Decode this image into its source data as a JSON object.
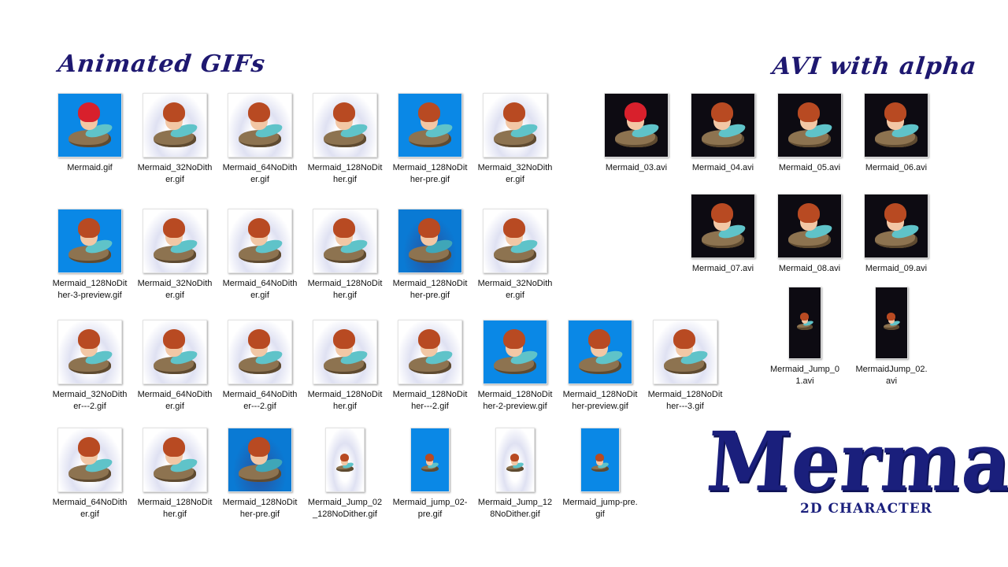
{
  "sections": {
    "gifs_title": "Animated GIFs",
    "avi_title": "AVI with alpha"
  },
  "files": [
    {
      "name": "Mermaid.gif",
      "bg": "blue",
      "icon": "mermaid-thumbnail-icon"
    },
    {
      "name": "Mermaid_32NoDither.gif",
      "bg": "white",
      "icon": "mermaid-thumbnail-icon"
    },
    {
      "name": "Mermaid_64NoDither.gif",
      "bg": "white",
      "icon": "mermaid-thumbnail-icon"
    },
    {
      "name": "Mermaid_128NoDither.gif",
      "bg": "white",
      "icon": "mermaid-thumbnail-icon"
    },
    {
      "name": "Mermaid_128NoDither-pre.gif",
      "bg": "blue",
      "icon": "mermaid-thumbnail-icon"
    },
    {
      "name": "Mermaid_32NoDither.gif",
      "bg": "white",
      "icon": "mermaid-thumbnail-icon"
    },
    {
      "name": "Mermaid_128NoDither-3-preview.gif",
      "bg": "blue",
      "icon": "mermaid-thumbnail-icon"
    },
    {
      "name": "Mermaid_32NoDither.gif",
      "bg": "white",
      "icon": "mermaid-thumbnail-icon"
    },
    {
      "name": "Mermaid_64NoDither.gif",
      "bg": "white",
      "icon": "mermaid-thumbnail-icon"
    },
    {
      "name": "Mermaid_128NoDither.gif",
      "bg": "white",
      "icon": "mermaid-thumbnail-icon"
    },
    {
      "name": "Mermaid_128NoDither-pre.gif",
      "bg": "blue2",
      "icon": "mermaid-thumbnail-icon"
    },
    {
      "name": "Mermaid_32NoDither.gif",
      "bg": "white",
      "icon": "mermaid-thumbnail-icon"
    },
    {
      "name": "Mermaid_32NoDither---2.gif",
      "bg": "white",
      "icon": "mermaid-thumbnail-icon"
    },
    {
      "name": "Mermaid_64NoDither.gif",
      "bg": "white",
      "icon": "mermaid-thumbnail-icon"
    },
    {
      "name": "Mermaid_64NoDither---2.gif",
      "bg": "white",
      "icon": "mermaid-thumbnail-icon"
    },
    {
      "name": "Mermaid_128NoDither.gif",
      "bg": "white",
      "icon": "mermaid-thumbnail-icon"
    },
    {
      "name": "Mermaid_128NoDither---2.gif",
      "bg": "white",
      "icon": "mermaid-thumbnail-icon"
    },
    {
      "name": "Mermaid_128NoDither-2-preview.gif",
      "bg": "blue",
      "icon": "mermaid-thumbnail-icon"
    },
    {
      "name": "Mermaid_128NoDither-preview.gif",
      "bg": "blue",
      "icon": "mermaid-thumbnail-icon"
    },
    {
      "name": "Mermaid_128NoDither---3.gif",
      "bg": "white",
      "icon": "mermaid-thumbnail-icon"
    },
    {
      "name": "Mermaid_64NoDither.gif",
      "bg": "white",
      "icon": "mermaid-thumbnail-icon"
    },
    {
      "name": "Mermaid_128NoDither.gif",
      "bg": "white",
      "icon": "mermaid-thumbnail-icon"
    },
    {
      "name": "Mermaid_128NoDither-pre.gif",
      "bg": "blue2",
      "icon": "mermaid-thumbnail-icon"
    },
    {
      "name": "Mermaid_Jump_02_128NoDither.gif",
      "bg": "white",
      "icon": "mermaid-jump-thumbnail-icon"
    },
    {
      "name": "Mermaid_jump_02-pre.gif",
      "bg": "blue",
      "icon": "mermaid-jump-thumbnail-icon"
    },
    {
      "name": "Mermaid_Jump_128NoDither.gif",
      "bg": "white",
      "icon": "mermaid-jump-thumbnail-icon"
    },
    {
      "name": "Mermaid_jump-pre.gif",
      "bg": "blue",
      "icon": "mermaid-jump-thumbnail-icon"
    },
    {
      "name": "Mermaid_03.avi",
      "bg": "black",
      "icon": "mermaid-video-thumbnail-icon"
    },
    {
      "name": "Mermaid_04.avi",
      "bg": "black",
      "icon": "mermaid-video-thumbnail-icon"
    },
    {
      "name": "Mermaid_05.avi",
      "bg": "black",
      "icon": "mermaid-video-thumbnail-icon"
    },
    {
      "name": "Mermaid_06.avi",
      "bg": "black",
      "icon": "mermaid-video-thumbnail-icon"
    },
    {
      "name": "Mermaid_07.avi",
      "bg": "black",
      "icon": "mermaid-video-thumbnail-icon"
    },
    {
      "name": "Mermaid_08.avi",
      "bg": "black",
      "icon": "mermaid-video-thumbnail-icon"
    },
    {
      "name": "Mermaid_09.avi",
      "bg": "black",
      "icon": "mermaid-video-thumbnail-icon"
    },
    {
      "name": "Mermaid_Jump_01.avi",
      "bg": "black",
      "icon": "mermaid-jump-video-thumbnail-icon"
    },
    {
      "name": "MermaidJump_02.avi",
      "bg": "black",
      "icon": "mermaid-jump-video-thumbnail-icon"
    }
  ],
  "logo": {
    "title": "Mermaid",
    "subtitle": "2D CHARACTER",
    "color": "#1a1f7c"
  },
  "colors": {
    "title": "#1e1870",
    "thumb_blue": "#0a88e6",
    "thumb_black": "#0d0b12"
  }
}
